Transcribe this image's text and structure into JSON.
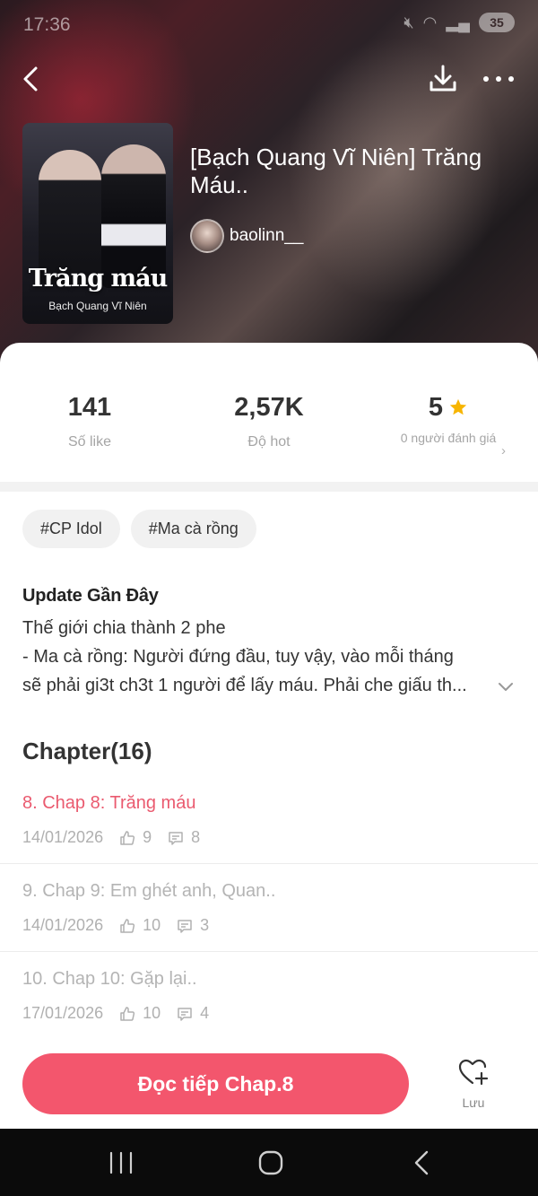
{
  "status_bar": {
    "time": "17:36",
    "battery": "35"
  },
  "story": {
    "title": "[Bạch Quang Vĩ Niên] Trăng Máu..",
    "author": "baolinn__",
    "cover_title": "Trăng máu",
    "cover_subtitle": "Bạch Quang Vĩ Niên"
  },
  "stats": {
    "likes_value": "141",
    "likes_label": "Số like",
    "hot_value": "2,57K",
    "hot_label": "Độ hot",
    "rating_value": "5",
    "rating_label": "0 người đánh giá"
  },
  "tags": [
    "#CP Idol",
    "#Ma cà rồng"
  ],
  "description": {
    "heading": "Update Gần Đây",
    "lines": [
      "Thế giới chia thành 2 phe",
      "- Ma cà rồng: Người đứng đầu, tuy vậy, vào mỗi tháng",
      "sẽ phải gi3t ch3t 1 người để lấy máu. Phải che giấu th..."
    ]
  },
  "chapters": {
    "heading": "Chapter(16)",
    "items": [
      {
        "title": "8. Chap 8: Trăng máu",
        "date": "14/01/2026",
        "likes": "9",
        "comments": "8"
      },
      {
        "title": "9. Chap 9: Em ghét anh, Quan..",
        "date": "14/01/2026",
        "likes": "10",
        "comments": "3"
      },
      {
        "title": "10. Chap 10: Gặp lại..",
        "date": "17/01/2026",
        "likes": "10",
        "comments": "4"
      }
    ]
  },
  "actions": {
    "read_label": "Đọc tiếp Chap.8",
    "save_label": "Lưu"
  },
  "colors": {
    "accent": "#f3566d",
    "active_chapter": "#ea5a6f",
    "star": "#f7b500"
  }
}
